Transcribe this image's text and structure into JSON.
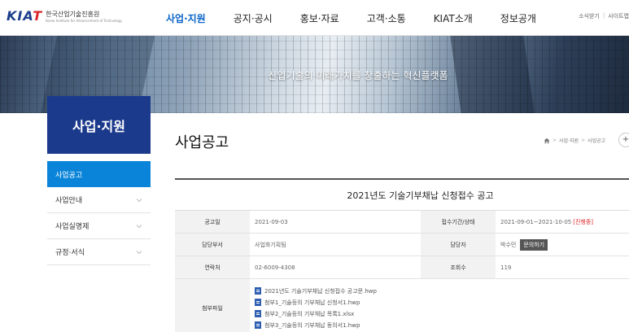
{
  "header": {
    "logo_mark": "KIAT",
    "logo_kr": "한국산업기술진흥원",
    "logo_en": "Korea Institute for Advancement of Technology",
    "nav": [
      "사업·지원",
      "공지·공시",
      "홍보·자료",
      "고객·소통",
      "KIAT소개",
      "정보공개"
    ],
    "util": [
      "소식받기",
      "사이트맵"
    ]
  },
  "hero": {
    "slogan": "산업기술의 미래가치를 창출하는 혁신플랫폼"
  },
  "sidebar": {
    "title": "사업·지원",
    "items": [
      {
        "label": "사업공고"
      },
      {
        "label": "사업안내"
      },
      {
        "label": "사업실명제"
      },
      {
        "label": "규정·서식"
      }
    ]
  },
  "content": {
    "page_title": "사업공고",
    "breadcrumb": [
      "사업·지원",
      "사업공고"
    ],
    "notice_title": "2021년도 기술기부채납 신청접수 공고",
    "info": {
      "posted_label": "공고일",
      "posted_value": "2021-09-03",
      "period_label": "접수기간/상태",
      "period_value": "2021-09-01~2021-10-05",
      "status_value": "[진행중]",
      "dept_label": "담당부서",
      "dept_value": "사업화기획팀",
      "manager_label": "담당자",
      "manager_value": "박수민",
      "inquiry_label": "문의하기",
      "contact_label": "연락처",
      "contact_value": "02-6009-4308",
      "views_label": "조회수",
      "views_value": "119",
      "files_label": "첨부파일",
      "files": [
        "2021년도 기술기부채납 신청접수 공고문.hwp",
        "첨부1_기술등의 기부채납 신청서1.hwp",
        "첨부2_기술등의 기부채납 목록1.xlsx",
        "첨부3_기술등의 기부채납 동의서1.hwp"
      ]
    }
  }
}
